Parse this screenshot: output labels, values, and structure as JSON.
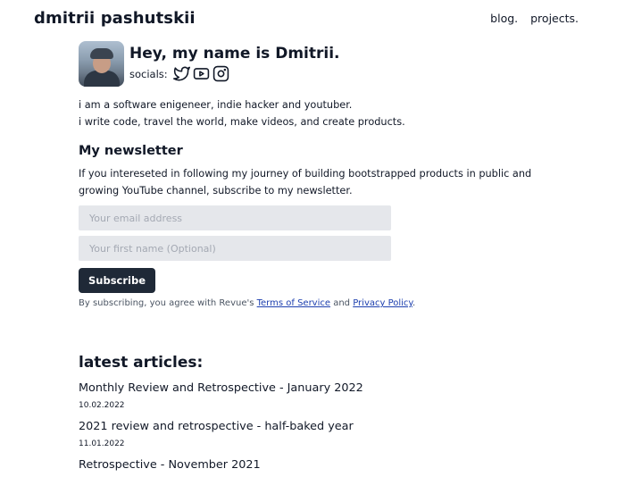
{
  "header": {
    "site_title": "dmitrii pashutskii",
    "nav": [
      {
        "label": "blog."
      },
      {
        "label": "projects."
      }
    ]
  },
  "hero": {
    "greeting": "Hey, my name is Dmitrii.",
    "socials_label": "socials:",
    "socials": [
      {
        "icon": "twitter-icon"
      },
      {
        "icon": "youtube-icon"
      },
      {
        "icon": "instagram-icon"
      }
    ]
  },
  "bio": {
    "line1": "i am a software enigeneer, indie hacker and youtuber.",
    "line2": "i write code, travel the world, make videos, and create products."
  },
  "newsletter": {
    "heading": "My newsletter",
    "description": "If you intereseted in following my journey of building bootstrapped products in public and growing YouTube channel, subscribe to my newsletter.",
    "email_placeholder": "Your email address",
    "name_placeholder": "Your first name (Optional)",
    "subscribe_label": "Subscribe",
    "terms_prefix": "By subscribing, you agree with Revue's ",
    "terms_link": "Terms of Service",
    "terms_and": " and ",
    "privacy_link": "Privacy Policy",
    "terms_suffix": "."
  },
  "articles": {
    "heading": "latest articles:",
    "items": [
      {
        "title": "Monthly Review and Retrospective - January 2022",
        "date": "10.02.2022"
      },
      {
        "title": "2021 review and retrospective - half-baked year",
        "date": "11.01.2022"
      },
      {
        "title": "Retrospective - November 2021",
        "date": ""
      }
    ]
  },
  "colors": {
    "text": "#111827",
    "input_bg": "#e5e7eb",
    "button_bg": "#1f2937",
    "link": "#1e40af"
  }
}
